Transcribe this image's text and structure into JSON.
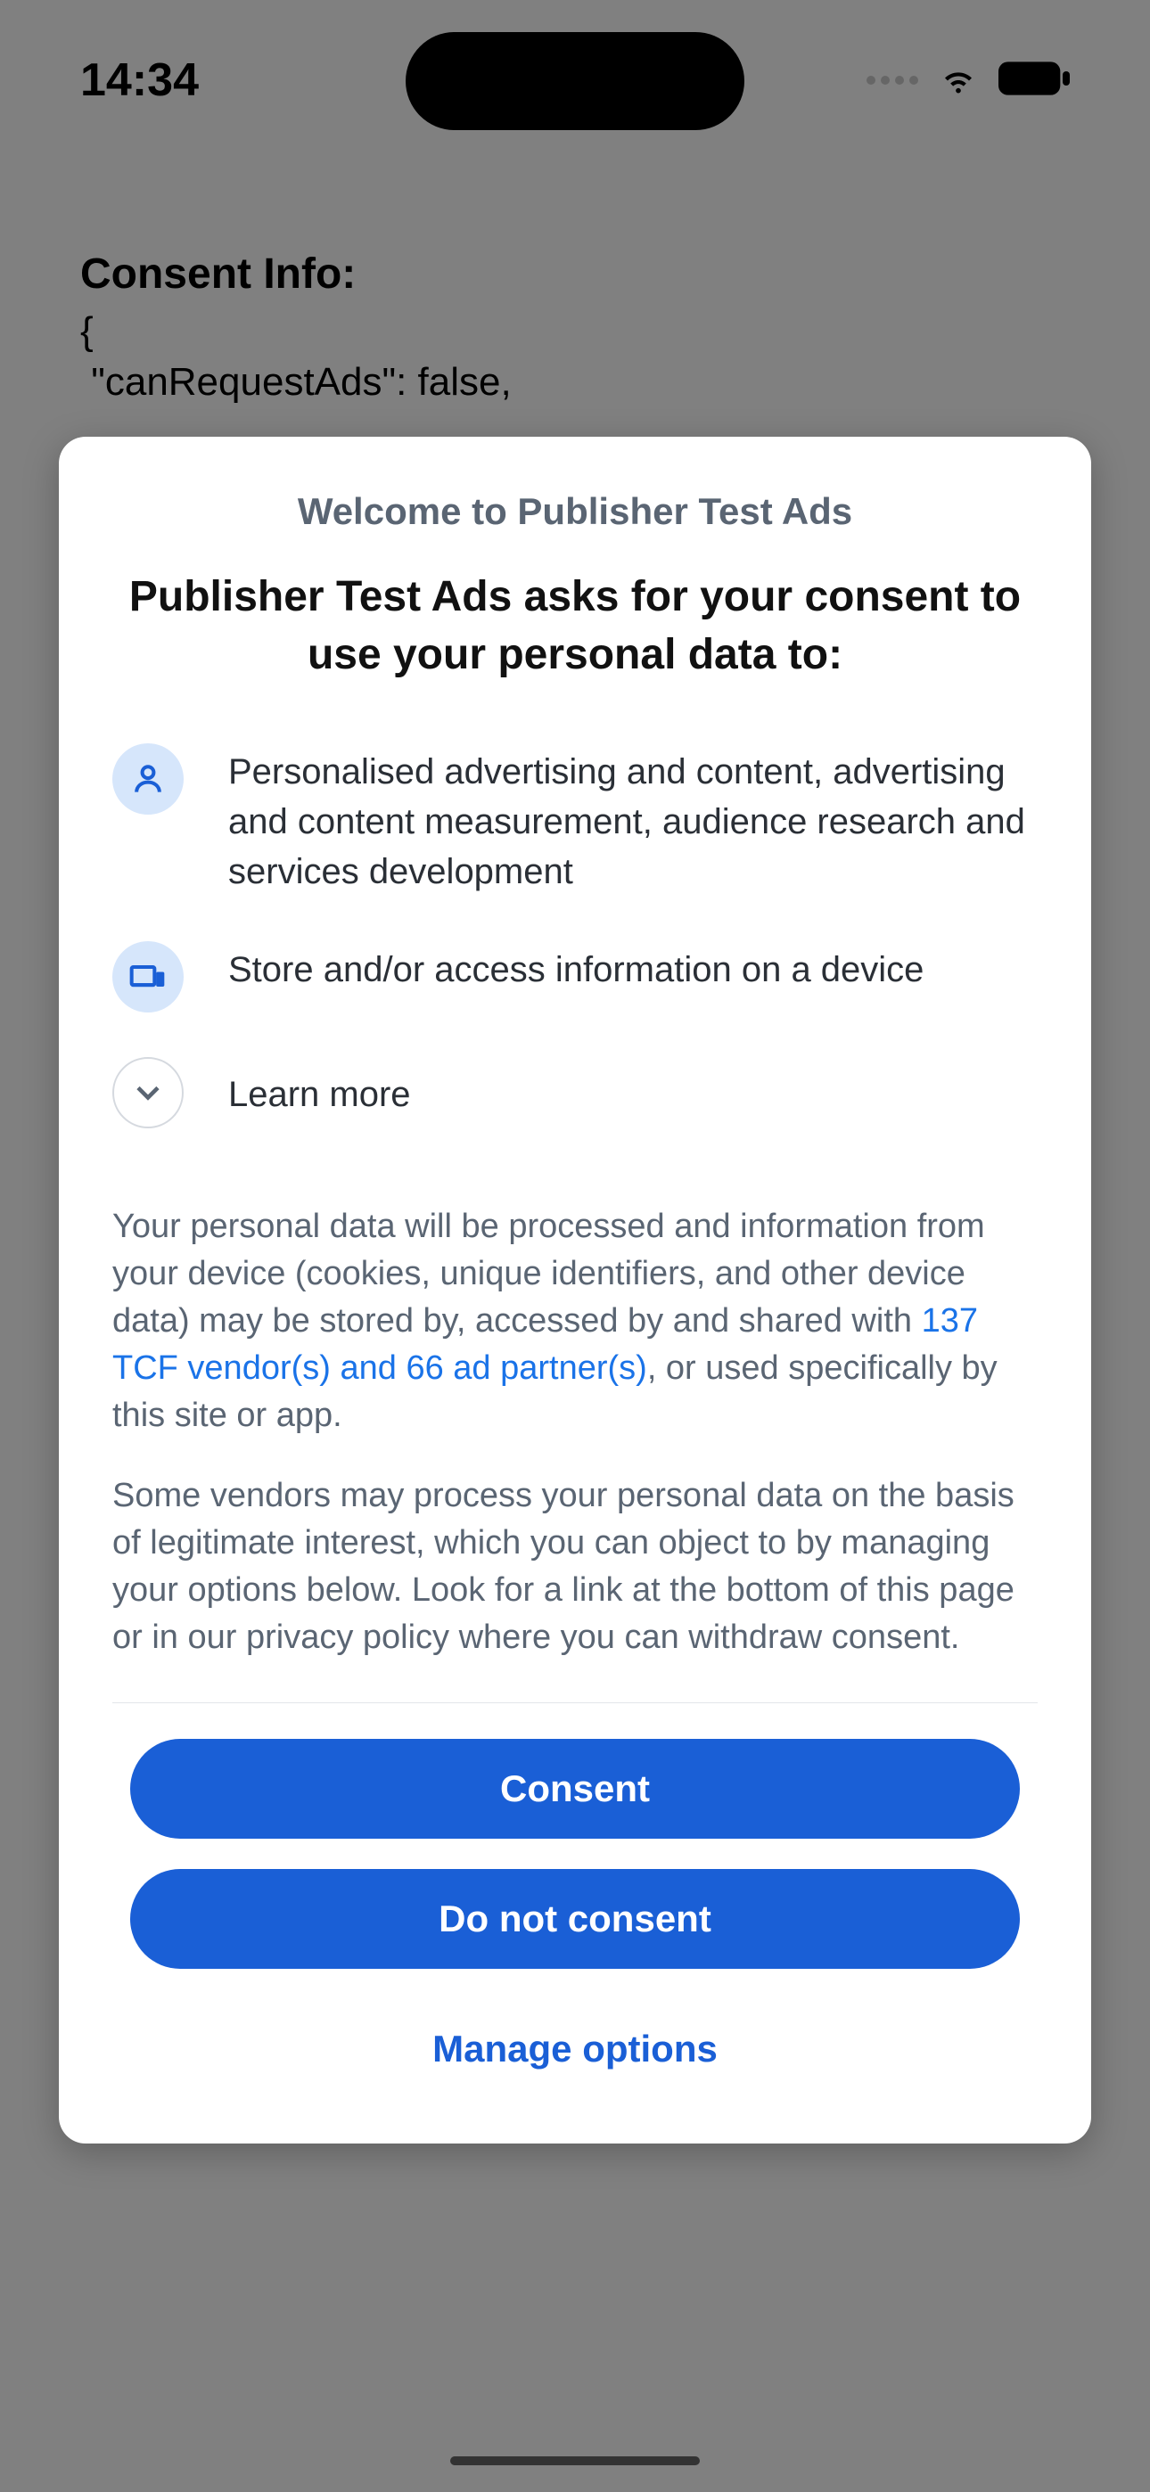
{
  "status": {
    "time": "14:34"
  },
  "background": {
    "heading": "Consent Info:",
    "json_line1": "{",
    "json_line2": " \"canRequestAds\": false,"
  },
  "dialog": {
    "welcome": "Welcome to Publisher Test Ads",
    "title": "Publisher Test Ads asks for your consent to use your personal data to:",
    "purposes": [
      "Personalised advertising and content, advertising and content measurement, audience research and services development",
      "Store and/or access information on a device"
    ],
    "learn_more": "Learn more",
    "body1_pre": "Your personal data will be processed and information from your device (cookies, unique identifiers, and other device data) may be stored by, accessed by and shared with ",
    "body1_link": "137 TCF vendor(s) and 66 ad partner(s)",
    "body1_post": ", or used specifically by this site or app.",
    "body2": "Some vendors may process your personal data on the basis of legitimate interest, which you can object to by managing your options below. Look for a link at the bottom of this page or in our privacy policy where you can withdraw consent.",
    "consent_button": "Consent",
    "do_not_consent_button": "Do not consent",
    "manage_options_button": "Manage options"
  }
}
